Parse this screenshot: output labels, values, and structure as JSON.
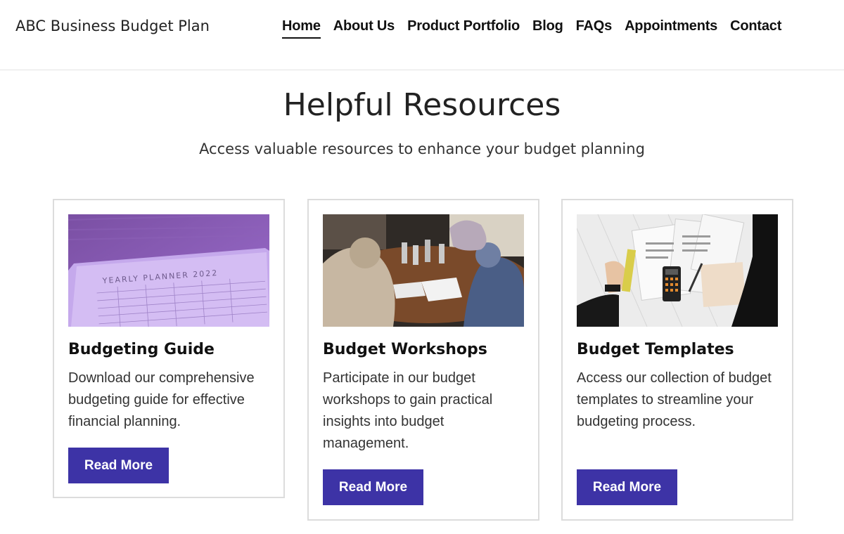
{
  "header": {
    "brand": "ABC Business Budget Plan",
    "nav": [
      {
        "label": "Home",
        "active": true
      },
      {
        "label": "About Us"
      },
      {
        "label": "Product Portfolio"
      },
      {
        "label": "Blog"
      },
      {
        "label": "FAQs"
      },
      {
        "label": "Appointments"
      },
      {
        "label": "Contact"
      }
    ]
  },
  "main": {
    "title": "Helpful Resources",
    "subtitle": "Access valuable resources to enhance your budget planning",
    "cards": [
      {
        "title": "Budgeting Guide",
        "description": "Download our comprehensive budgeting guide for effective financial planning.",
        "button": "Read More",
        "image": {
          "name": "yearly-planner-image",
          "printed_text": "YEARLY PLANNER 2022"
        }
      },
      {
        "title": "Budget Workshops",
        "description": "Participate in our budget workshops to gain practical insights into budget management.",
        "button": "Read More",
        "image": {
          "name": "workshop-photo"
        }
      },
      {
        "title": "Budget Templates",
        "description": "Access our collection of budget templates to streamline your budgeting process.",
        "button": "Read More",
        "image": {
          "name": "templates-desk-photo"
        }
      }
    ]
  },
  "colors": {
    "accent": "#3d33a6",
    "divider": "#e3e3e3",
    "card_border": "#dcdcdc"
  }
}
